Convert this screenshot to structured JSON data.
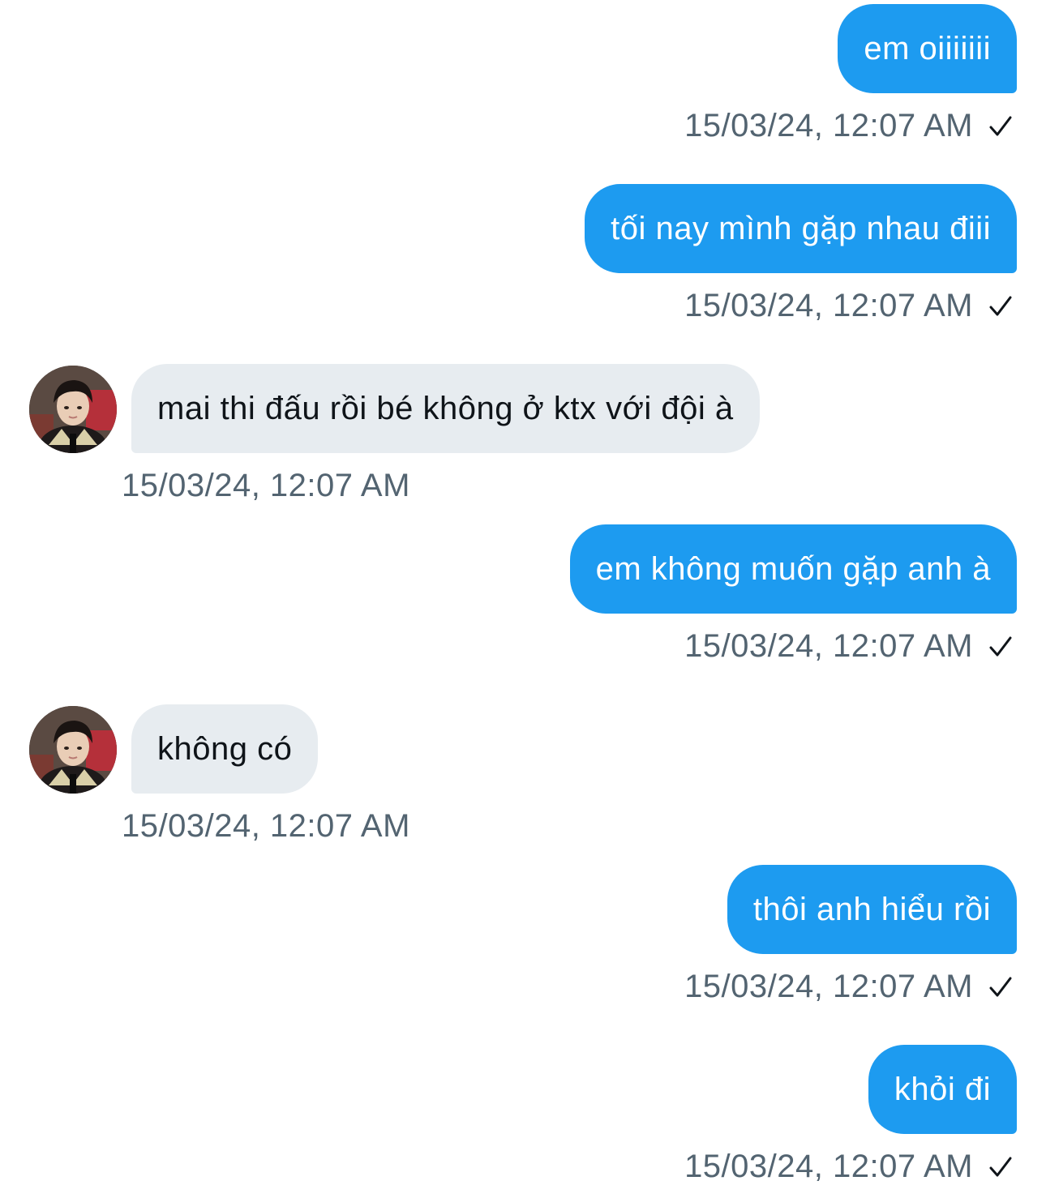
{
  "conversation": {
    "messages": [
      {
        "direction": "sent",
        "text": "em oiiiiiii",
        "timestamp": "15/03/24, 12:07 AM",
        "read_icon": "check-icon"
      },
      {
        "direction": "sent",
        "text": "tối nay mình gặp nhau điii",
        "timestamp": "15/03/24, 12:07 AM",
        "read_icon": "check-icon"
      },
      {
        "direction": "received",
        "text": "mai thi đấu rồi bé không ở ktx với đội à",
        "timestamp": "15/03/24, 12:07 AM",
        "avatar": "avatar-photo"
      },
      {
        "direction": "sent",
        "text": "em không muốn gặp anh à",
        "timestamp": "15/03/24, 12:07 AM",
        "read_icon": "check-icon"
      },
      {
        "direction": "received",
        "text": "không có",
        "timestamp": "15/03/24, 12:07 AM",
        "avatar": "avatar-photo"
      },
      {
        "direction": "sent",
        "text": "thôi anh hiểu rồi",
        "timestamp": "15/03/24, 12:07 AM",
        "read_icon": "check-icon"
      },
      {
        "direction": "sent",
        "text": "khỏi đi",
        "timestamp": "15/03/24, 12:07 AM",
        "read_icon": "check-icon"
      }
    ]
  },
  "colors": {
    "sent_bubble": "#1d9bf0",
    "received_bubble": "#e7ecf0",
    "timestamp": "#536471"
  }
}
